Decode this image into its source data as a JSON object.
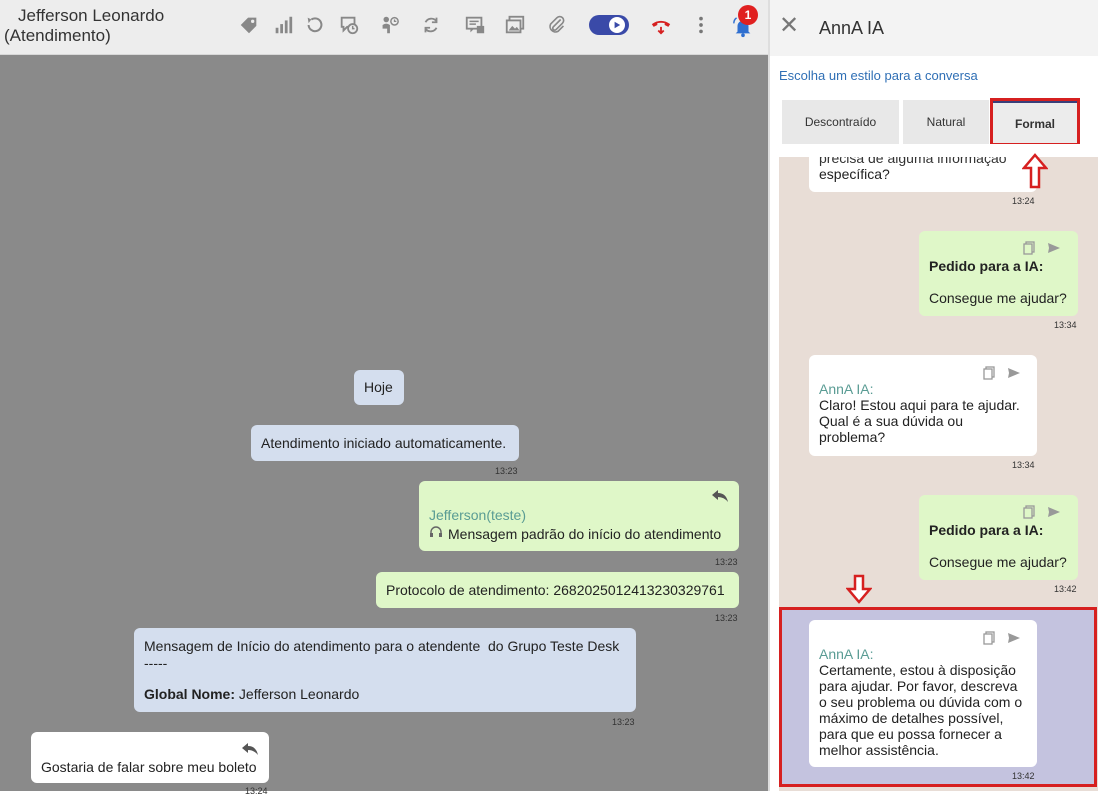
{
  "header": {
    "contact_name": "Jefferson Leonardo",
    "status": "(Atendimento)",
    "notification_count": "1",
    "icons": [
      "tag-icon",
      "signal-icon",
      "history-icon",
      "schedule-icon",
      "transfer-icon",
      "refresh-icon",
      "chat-template-icon",
      "gallery-icon",
      "attach-icon",
      "toggle-icon",
      "hangup-icon",
      "more-icon",
      "notification-bell-icon"
    ]
  },
  "chat": {
    "date_chip": "Hoje",
    "messages": [
      {
        "text": "Atendimento iniciado automaticamente.",
        "time": "13:23"
      },
      {
        "sender": "Jefferson(teste)",
        "text": "Mensagem padrão do início do atendimento",
        "time": "13:23"
      },
      {
        "text": "Protocolo de atendimento: 2682025012413230329761",
        "time": "13:23"
      },
      {
        "line1": "Mensagem de Início do atendimento para o atendente  do Grupo Teste Desk",
        "line2": "-----",
        "label": "Global Nome:",
        "value": " Jefferson Leonardo",
        "time": "13:23"
      },
      {
        "text": "Gostaria de falar sobre meu boleto",
        "time": "13:24"
      }
    ]
  },
  "panel": {
    "title": "AnnA IA",
    "subtitle": "Escolha um estilo para a conversa",
    "tabs": [
      "Descontraído",
      "Natural",
      "Formal"
    ],
    "active_tab": "Formal",
    "messages": [
      {
        "partial": "precisa de alguma informação",
        "text": "específica?",
        "time": "13:24"
      },
      {
        "label": "Pedido para a IA:",
        "text": "Consegue me ajudar?",
        "time": "13:34"
      },
      {
        "sender": "AnnA IA:",
        "lines": [
          "Claro! Estou aqui para te ajudar.",
          "Qual é a sua dúvida ou",
          "problema?"
        ],
        "time": "13:34"
      },
      {
        "label": "Pedido para a IA:",
        "text": "Consegue me ajudar?",
        "time": "13:42"
      },
      {
        "sender": "AnnA IA:",
        "lines": [
          "Certamente, estou à disposição",
          "para ajudar. Por favor, descreva",
          "o seu problema ou dúvida com o",
          "máximo de detalhes possível,",
          "para que eu possa fornecer a",
          "melhor assistência."
        ],
        "time": "13:42"
      }
    ]
  },
  "colors": {
    "accent_red": "#d62020",
    "link_blue": "#2f6fb5",
    "sender_teal": "#5a9c94"
  }
}
